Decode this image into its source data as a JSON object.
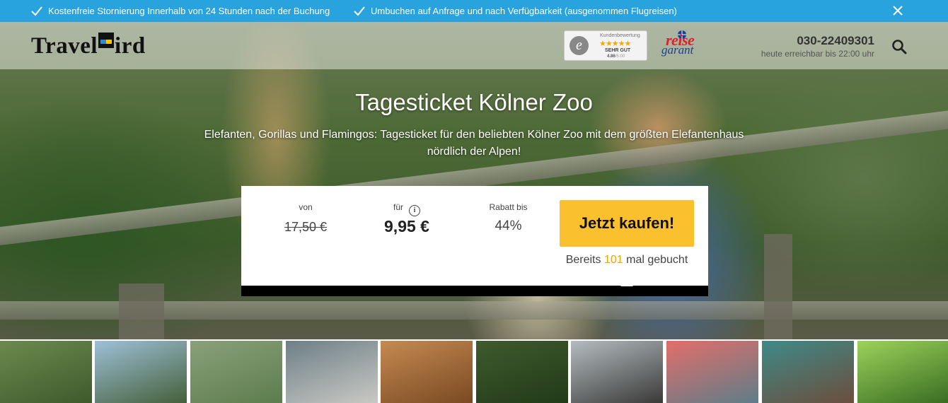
{
  "notice": {
    "items": [
      "Kostenfreie Stornierung Innerhalb von 24 Stunden nach der Buchung",
      "Umbuchen auf Anfrage und nach Verfügbarkeit (ausgenommen Flugreisen)"
    ],
    "bg_color": "#29a3dd"
  },
  "header": {
    "logo_left": "Travel",
    "logo_right": "ird",
    "rating": {
      "title": "Kundenbewertung",
      "stars": "★★★★★",
      "text": "SEHR GUT",
      "score": "4.86",
      "score_max": "/5.00"
    },
    "reisegarant": {
      "reise": "reise",
      "garant": "garant"
    },
    "phone": "030-22409301",
    "phone_hours": "heute erreichbar bis 22:00 uhr"
  },
  "hero": {
    "title": "Tagesticket Kölner Zoo",
    "subtitle_line1": "Elefanten, Gorillas und Flamingos: Tagesticket für den beliebten Kölner Zoo mit dem größten Elefantenhaus",
    "subtitle_line2": "nördlich der Alpen!"
  },
  "price": {
    "from_label": "von",
    "from_value": "17,50 €",
    "for_label": "für",
    "for_value": "9,95 €",
    "discount_label": "Rabatt bis",
    "discount_value": "44%",
    "buy_button": "Jetzt kaufen!",
    "booked_prefix": "Bereits",
    "booked_count": "101",
    "booked_suffix": "mal gebucht",
    "accent_color": "#fbc02d"
  },
  "thumbnails": [
    {
      "name": "thumb-elephant-enclosure",
      "colors": [
        "#6c8a4e",
        "#3e5a2c"
      ]
    },
    {
      "name": "thumb-elephants-trees",
      "colors": [
        "#9ec0d8",
        "#44603a"
      ]
    },
    {
      "name": "thumb-flamingo-pond",
      "colors": [
        "#8aa07a",
        "#5c7d4d"
      ]
    },
    {
      "name": "thumb-snow-leopard",
      "colors": [
        "#6d7f86",
        "#c9c9c4"
      ]
    },
    {
      "name": "thumb-giraffe",
      "colors": [
        "#c48a52",
        "#7a4a22"
      ]
    },
    {
      "name": "thumb-forest-path",
      "colors": [
        "#3f5a2e",
        "#223a18"
      ]
    },
    {
      "name": "thumb-sea-lions",
      "colors": [
        "#b4bcc0",
        "#3a3a38"
      ]
    },
    {
      "name": "thumb-flamingos",
      "colors": [
        "#e36e6a",
        "#5e7d88"
      ]
    },
    {
      "name": "thumb-hippo",
      "colors": [
        "#3f8a88",
        "#6b4e3c"
      ]
    },
    {
      "name": "thumb-chameleon",
      "colors": [
        "#9bd35a",
        "#3b6d22"
      ]
    }
  ]
}
